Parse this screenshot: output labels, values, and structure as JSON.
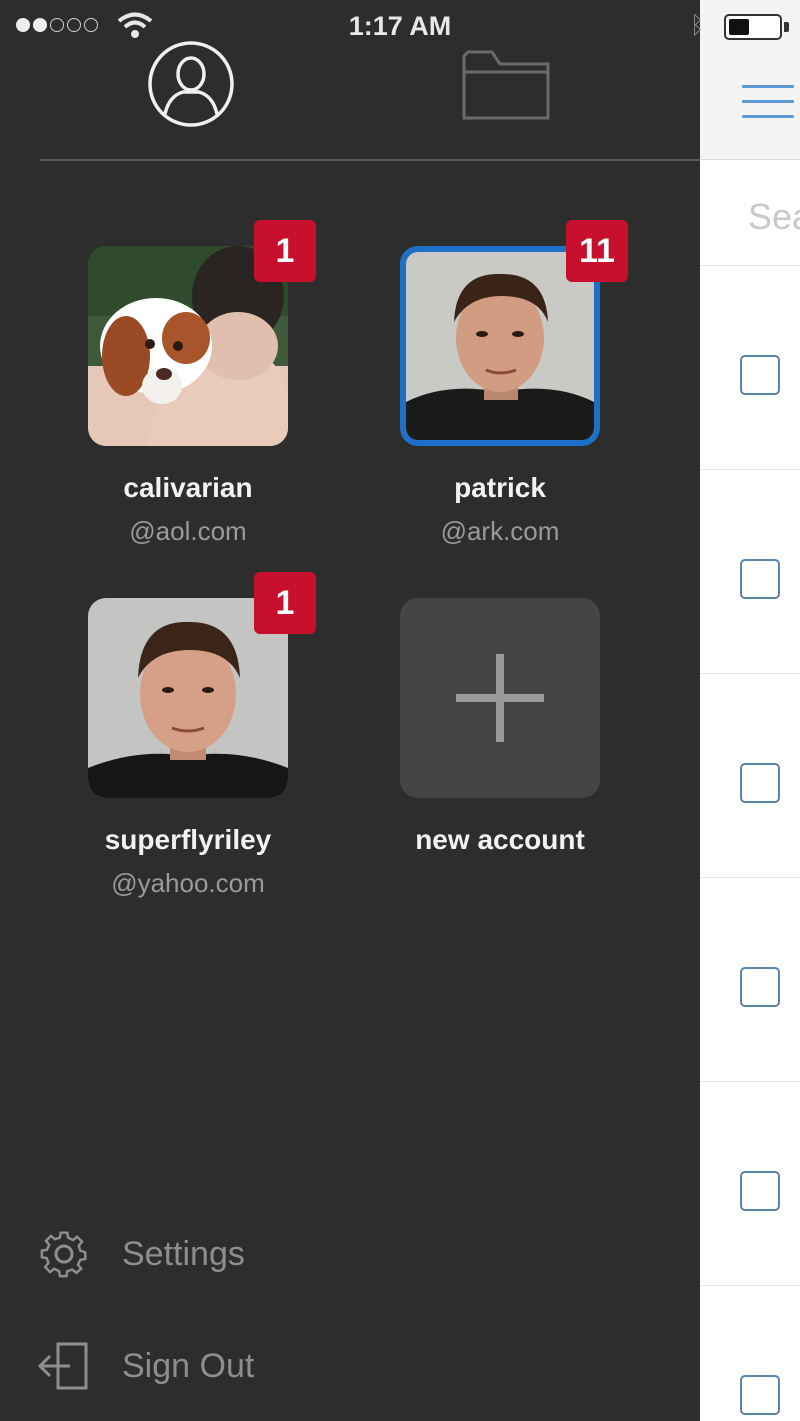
{
  "status_bar": {
    "time": "1:17 AM"
  },
  "drawer": {
    "tabs": [
      {
        "name": "profile",
        "icon": "person-icon"
      },
      {
        "name": "folders",
        "icon": "folder-icon"
      }
    ],
    "accounts": [
      {
        "name": "calivarian",
        "domain": "@aol.com",
        "badge": "1",
        "selected": false
      },
      {
        "name": "patrick",
        "domain": "@ark.com",
        "badge": "11",
        "selected": true
      },
      {
        "name": "superflyriley",
        "domain": "@yahoo.com",
        "badge": "1",
        "selected": false
      }
    ],
    "new_account_label": "new account",
    "menu": {
      "settings_label": "Settings",
      "signout_label": "Sign Out"
    }
  },
  "main_panel": {
    "search_placeholder": "Search"
  },
  "colors": {
    "drawer_bg": "#2d2d2d",
    "badge": "#c8102e",
    "selected_border": "#1e70c8",
    "accent": "#5b9bd5"
  }
}
